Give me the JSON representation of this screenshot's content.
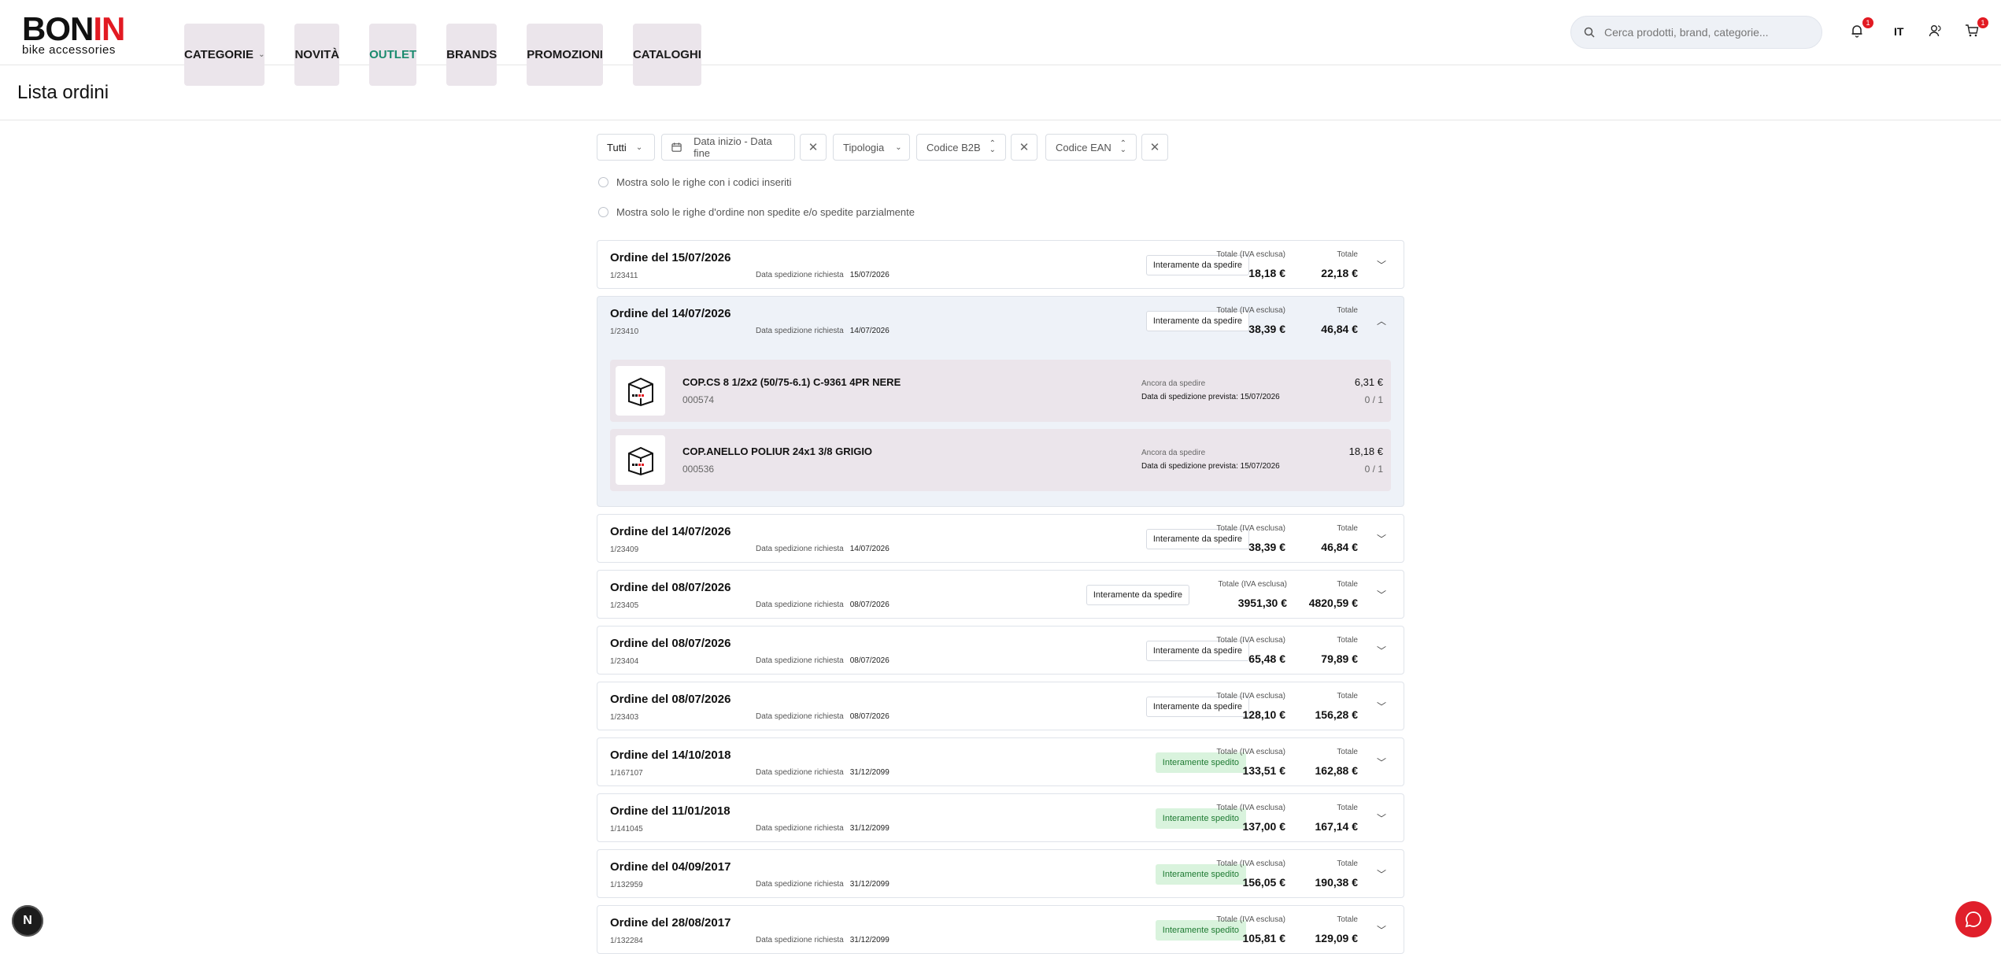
{
  "header": {
    "logo_word_a": "BON",
    "logo_word_b": "IN",
    "logo_sub": "bike accessories",
    "nav": [
      {
        "label": "Categorie",
        "has_chevron": true
      },
      {
        "label": "Novità"
      },
      {
        "label": "Outlet",
        "active_color": "#1a8a6e"
      },
      {
        "label": "Brands"
      },
      {
        "label": "Promozioni"
      },
      {
        "label": "Cataloghi"
      }
    ],
    "search_placeholder": "Cerca prodotti, brand, categorie...",
    "notifications_count": "1",
    "language": "IT",
    "cart_count": "1"
  },
  "page_title": "Lista ordini",
  "filters": {
    "status": "Tutti",
    "date_range_placeholder": "Data inizio - Data fine",
    "type_placeholder": "Tipologia",
    "b2b_code_placeholder": "Codice B2B",
    "ean_code_placeholder": "Codice EAN",
    "check_codes": "Mostra solo le righe con i codici inseriti",
    "check_unshipped": "Mostra solo le righe d'ordine non spedite e/o spedite parzialmente"
  },
  "labels": {
    "requested_date": "Data spedizione richiesta",
    "total_ex_vat": "Totale (IVA esclusa)",
    "total": "Totale",
    "still_to_ship": "Ancora da spedire",
    "expected_date": "Data di spedizione prevista:"
  },
  "orders": [
    {
      "title": "Ordine del 15/07/2026",
      "number": "1/23411",
      "date": "15/07/2026",
      "status": "Interamente da spedire",
      "shipped": false,
      "net": "18,18 €",
      "gross": "22,18 €",
      "expanded": false
    },
    {
      "title": "Ordine del 14/07/2026",
      "number": "1/23410",
      "date": "14/07/2026",
      "status": "Interamente da spedire",
      "shipped": false,
      "net": "38,39 €",
      "gross": "46,84 €",
      "expanded": true,
      "items": [
        {
          "name": "COP.CS 8 1/2x2 (50/75-6.1) C-9361 4PR NERE",
          "code": "000574",
          "expected": "15/07/2026",
          "price": "6,31 €",
          "qty": "0 / 1"
        },
        {
          "name": "COP.ANELLO POLIUR 24x1 3/8 GRIGIO",
          "code": "000536",
          "expected": "15/07/2026",
          "price": "18,18 €",
          "qty": "0 / 1"
        }
      ]
    },
    {
      "title": "Ordine del 14/07/2026",
      "number": "1/23409",
      "date": "14/07/2026",
      "status": "Interamente da spedire",
      "shipped": false,
      "net": "38,39 €",
      "gross": "46,84 €",
      "expanded": false
    },
    {
      "title": "Ordine del 08/07/2026",
      "number": "1/23405",
      "date": "08/07/2026",
      "status": "Interamente da spedire",
      "shipped": false,
      "net": "3951,30 €",
      "gross": "4820,59 €",
      "expanded": false
    },
    {
      "title": "Ordine del 08/07/2026",
      "number": "1/23404",
      "date": "08/07/2026",
      "status": "Interamente da spedire",
      "shipped": false,
      "net": "65,48 €",
      "gross": "79,89 €",
      "expanded": false
    },
    {
      "title": "Ordine del 08/07/2026",
      "number": "1/23403",
      "date": "08/07/2026",
      "status": "Interamente da spedire",
      "shipped": false,
      "net": "128,10 €",
      "gross": "156,28 €",
      "expanded": false
    },
    {
      "title": "Ordine del 14/10/2018",
      "number": "1/167107",
      "date": "31/12/2099",
      "status": "Interamente spedito",
      "shipped": true,
      "net": "133,51 €",
      "gross": "162,88 €",
      "expanded": false
    },
    {
      "title": "Ordine del 11/01/2018",
      "number": "1/141045",
      "date": "31/12/2099",
      "status": "Interamente spedito",
      "shipped": true,
      "net": "137,00 €",
      "gross": "167,14 €",
      "expanded": false
    },
    {
      "title": "Ordine del 04/09/2017",
      "number": "1/132959",
      "date": "31/12/2099",
      "status": "Interamente spedito",
      "shipped": true,
      "net": "156,05 €",
      "gross": "190,38 €",
      "expanded": false
    },
    {
      "title": "Ordine del 28/08/2017",
      "number": "1/132284",
      "date": "31/12/2099",
      "status": "Interamente spedito",
      "shipped": true,
      "net": "105,81 €",
      "gross": "129,09 €",
      "expanded": false
    }
  ],
  "colors": {
    "brand_red": "#e21a22",
    "outlet_green": "#1a8a6e",
    "shipped_bg": "#d9f3dd",
    "expanded_bg": "#eef2f8",
    "item_bg": "#ebe5eb"
  },
  "floating": {
    "n_button": "N"
  }
}
